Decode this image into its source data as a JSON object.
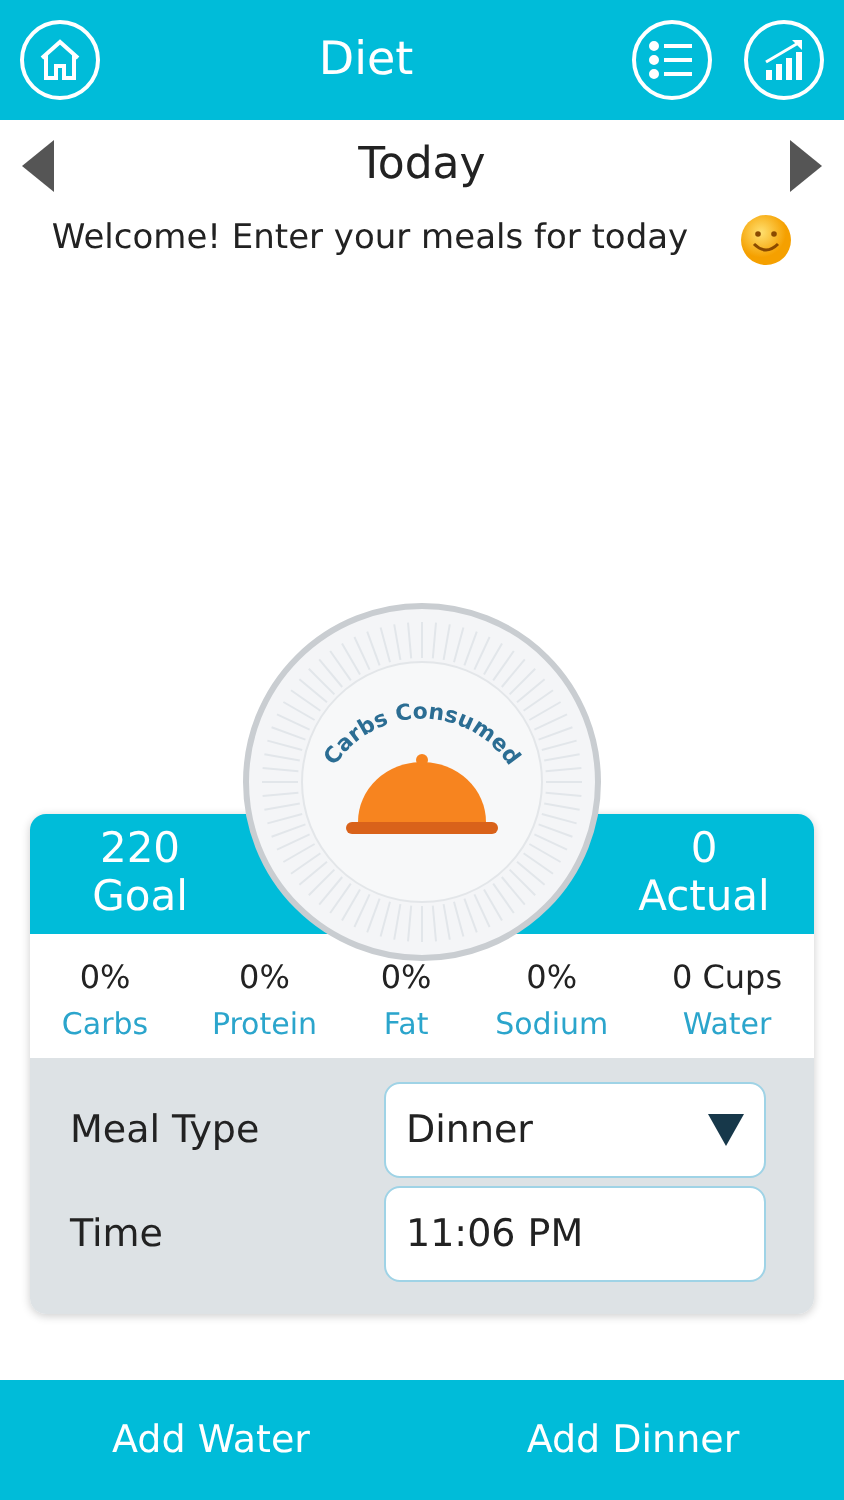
{
  "header": {
    "title": "Diet"
  },
  "date_nav": {
    "label": "Today"
  },
  "welcome": {
    "text": "Welcome! Enter your meals for today"
  },
  "plate": {
    "label": "Carbs Consumed"
  },
  "summary": [
    {
      "value": "220",
      "label": "Goal"
    },
    {
      "value": "0",
      "label": "Actual"
    }
  ],
  "stats": [
    {
      "value": "0%",
      "label": "Carbs"
    },
    {
      "value": "0%",
      "label": "Protein"
    },
    {
      "value": "0%",
      "label": "Fat"
    },
    {
      "value": "0%",
      "label": "Sodium"
    },
    {
      "value": "0 Cups",
      "label": "Water"
    }
  ],
  "form": [
    {
      "kind": "select",
      "label": "Meal Type",
      "value": "Dinner"
    },
    {
      "kind": "text",
      "label": "Time",
      "value": "11:06 PM"
    }
  ],
  "buttons": [
    "Add Water",
    "Add Dinner"
  ]
}
